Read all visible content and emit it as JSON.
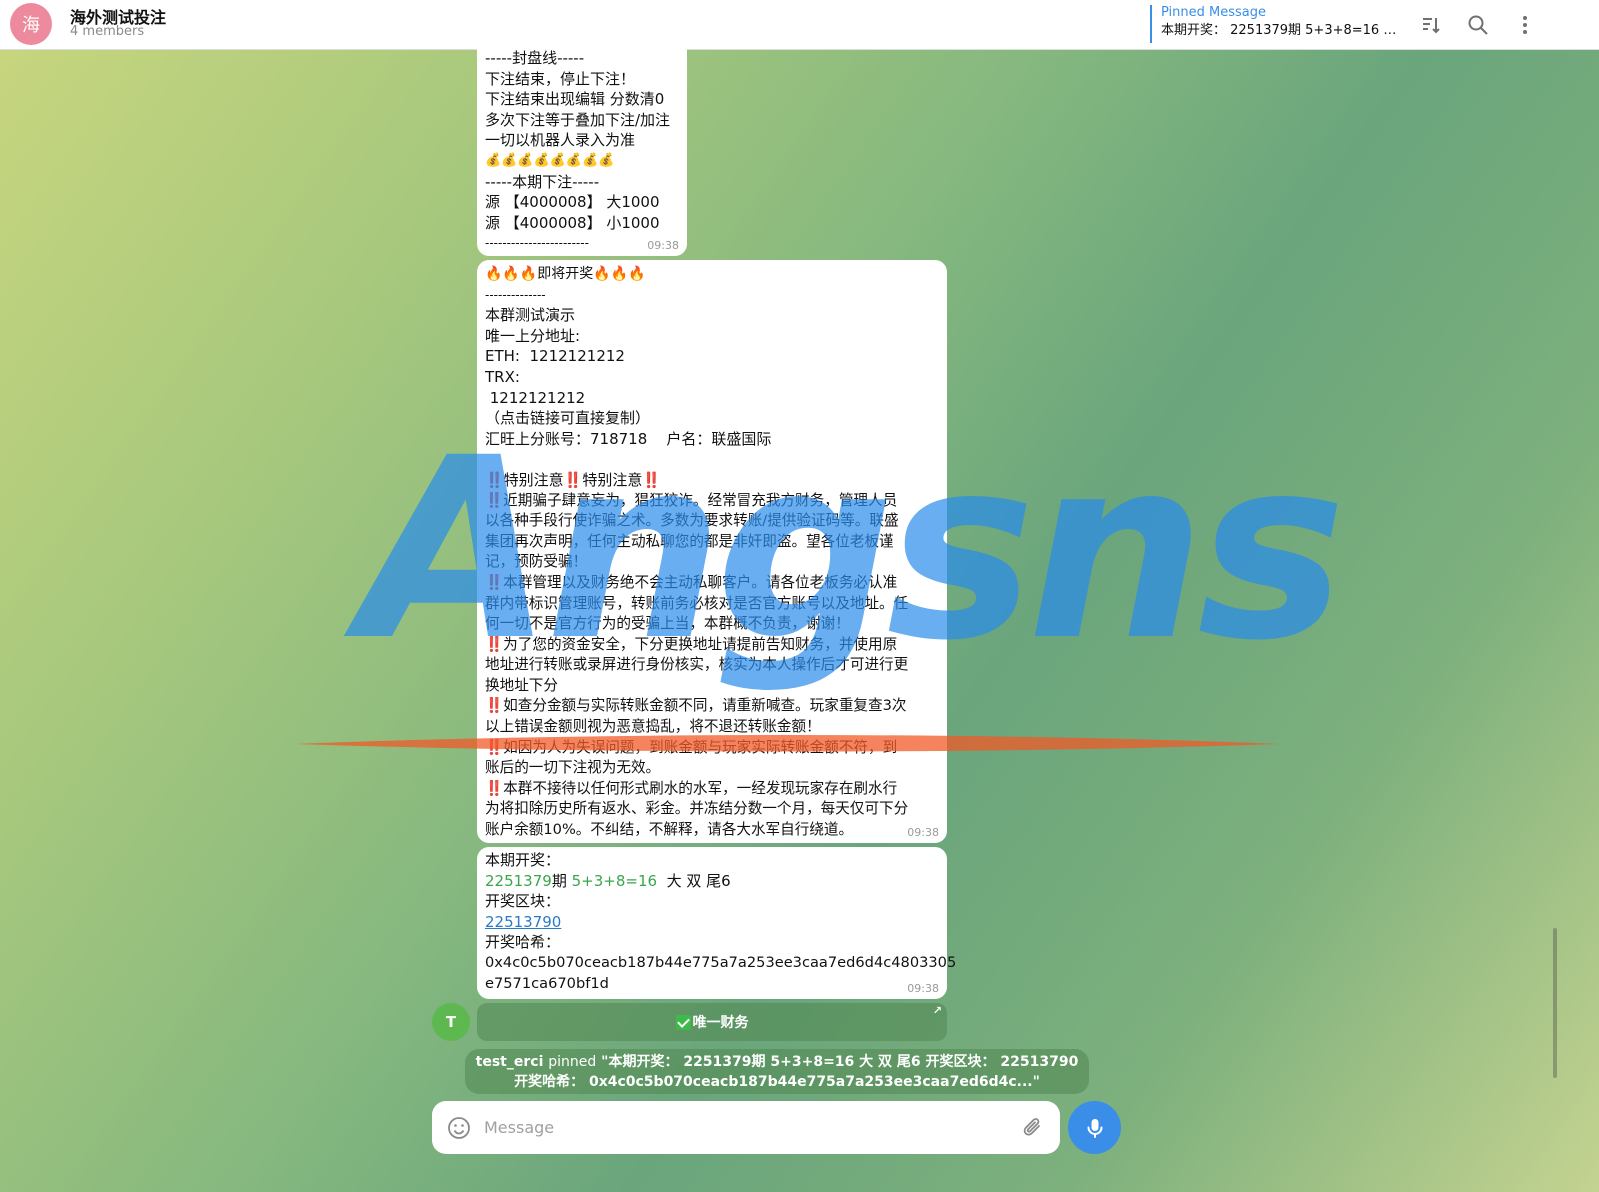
{
  "header": {
    "avatar_char": "海",
    "title": "海外测试投注",
    "subtitle": "4 members",
    "pinned_label": "Pinned Message",
    "pinned_text": "本期开奖： 2251379期 5+3+8=16 大…"
  },
  "icons": [
    "sort-icon",
    "search-icon",
    "more-icon",
    "emoji-icon",
    "paperclip-icon",
    "microphone-icon"
  ],
  "messages": {
    "m1": {
      "lines": [
        "-----封盘线-----",
        "下注结束，停止下注！",
        "下注结束出现编辑 分数清0",
        "多次下注等于叠加下注/加注",
        "一切以机器人录入为准",
        "💰💰💰💰💰💰💰💰",
        "-----本期下注-----",
        "源 【4000008】 大1000",
        "源 【4000008】 小1000",
        "------------------------"
      ],
      "time": "09:38"
    },
    "m2": {
      "l1": "🔥🔥🔥即将开奖🔥🔥🔥",
      "l2": "--------------",
      "l3": "本群测试演示",
      "l4": "唯一上分地址:",
      "l5": "ETH:  1212121212",
      "l6": "TRX:",
      "l7": " 1212121212",
      "l8": "（点击链接可直接复制）",
      "l9": "汇旺上分账号：718718    户名：联盛国际",
      "l10": "",
      "l11": "‼️特别注意‼️特别注意‼️",
      "l12": "‼️近期骗子肆意妄为，猖狂狡诈。经常冒充我方财务，管理人员",
      "l13": "以各种手段行使诈骗之术。多数为要求转账/提供验证码等。联盛",
      "l14": "集团再次声明，任何主动私聊您的都是非奸即盗。望各位老板谨",
      "l15": "记，预防受骗！",
      "l16": "‼️本群管理以及财务绝不会主动私聊客户。请各位老板务必认准",
      "l17": "群内带标识管理账号，转账前务必核对是否官方账号以及地址。任",
      "l18": "何一切不是官方行为的受骗上当，本群概不负责，谢谢！",
      "l19": "‼️为了您的资金安全，下分更换地址请提前告知财务，并使用原",
      "l20": "地址进行转账或录屏进行身份核实，核实为本人操作后才可进行更",
      "l21": "换地址下分",
      "l22": "‼️如查分金额与实际转账金额不同，请重新喊查。玩家重复查3次",
      "l23": "以上错误金额则视为恶意捣乱，将不退还转账金额！",
      "l24": "‼️如因为人为失误问题，到账金额与玩家实际转账金额不符，到",
      "l25": "账后的一切下注视为无效。",
      "l26": "‼️本群不接待以任何形式刷水的水军，一经发现玩家存在刷水行",
      "l27": "为将扣除历史所有返水、彩金。并冻结分数一个月，每天仅可下分",
      "l28": "账户余额10%。不纠结，不解释，请各大水军自行绕道。",
      "time": "09:38"
    },
    "m3": {
      "label_draw": "本期开奖：",
      "period": "2251379",
      "period_suffix": "期",
      "formula": "5+3+8=16",
      "result": "大 双 尾6",
      "label_block": "开奖区块：",
      "block": "22513790",
      "label_hash": "开奖哈希：",
      "hash1": "0x4c0c5b070ceacb187b44e775a7a253ee3caa7ed6d4c4803305",
      "hash2": "e7571ca670bf1d",
      "time": "09:38"
    }
  },
  "sender_avatar": "T",
  "inline_button": {
    "label": "唯一财务",
    "arrow": "↗"
  },
  "service": {
    "who": "test_erci",
    "action": "pinned",
    "text": "\"本期开奖： 2251379期 5+3+8=16 大 双 尾6 开奖区块： 22513790 开奖哈希： 0x4c0c5b070ceacb187b44e775a7a253ee3caa7ed6d4c...\""
  },
  "composer": {
    "placeholder": "Message"
  },
  "watermark": "Angsns",
  "colors": {
    "accent": "#3b8ee8",
    "link": "#2a7ac8",
    "green": "#3aa64c",
    "alert": "#d42b2b"
  }
}
